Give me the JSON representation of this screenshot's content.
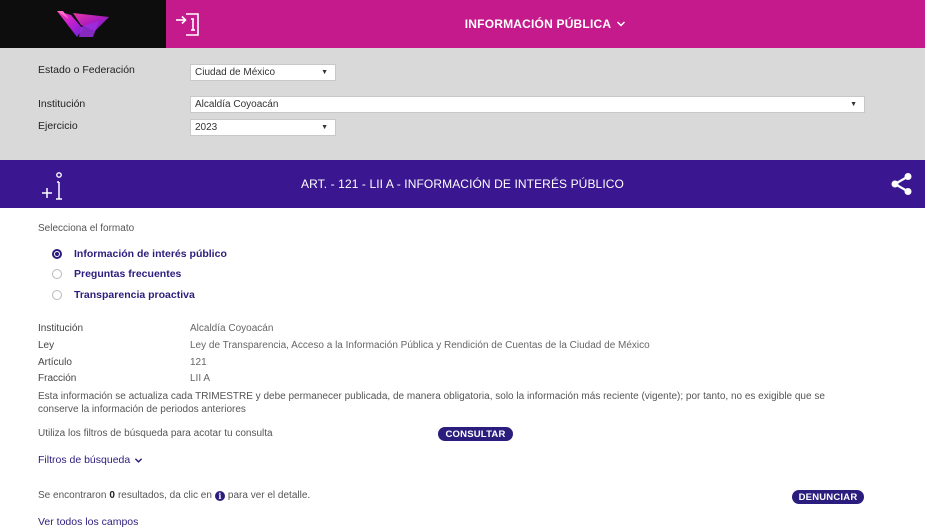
{
  "header": {
    "title": "INFORMACIÓN PÚBLICA",
    "colors": {
      "logo_bg": "#0d0d0d",
      "bar": "#c41a8c"
    }
  },
  "filters": {
    "estado_label": "Estado o Federación",
    "estado_value": "Ciudad de México",
    "institucion_label": "Institución",
    "institucion_value": "Alcaldía Coyoacán",
    "ejercicio_label": "Ejercicio",
    "ejercicio_value": "2023"
  },
  "band": {
    "title": "ART. - 121 - LII A - INFORMACIÓN DE INTERÉS PÚBLICO",
    "color": "#3a1791"
  },
  "format": {
    "label": "Selecciona el formato",
    "options": [
      {
        "label": "Información de interés público",
        "selected": true
      },
      {
        "label": "Preguntas frecuentes",
        "selected": false
      },
      {
        "label": "Transparencia proactiva",
        "selected": false
      }
    ]
  },
  "details": {
    "institucion_key": "Institución",
    "institucion_val": "Alcaldía Coyoacán",
    "ley_key": "Ley",
    "ley_val": "Ley de Transparencia, Acceso a la Información Pública y Rendición de Cuentas de la Ciudad de México",
    "articulo_key": "Artículo",
    "articulo_val": "121",
    "fraccion_key": "Fracción",
    "fraccion_val": "LII A",
    "note": "Esta información se actualiza cada TRIMESTRE y debe permanecer publicada, de manera obligatoria, solo la información más reciente (vigente); por tanto, no es exigible que se conserve la información de periodos anteriores"
  },
  "search": {
    "hint": "Utiliza los filtros de búsqueda para acotar tu consulta",
    "consultar": "CONSULTAR",
    "filtros_link": "Filtros de búsqueda"
  },
  "results": {
    "prefix": "Se encontraron",
    "count": "0",
    "middle": "resultados, da clic en",
    "suffix": "para ver el detalle.",
    "denunciar": "DENUNCIAR",
    "ver_todos": "Ver todos los campos"
  }
}
